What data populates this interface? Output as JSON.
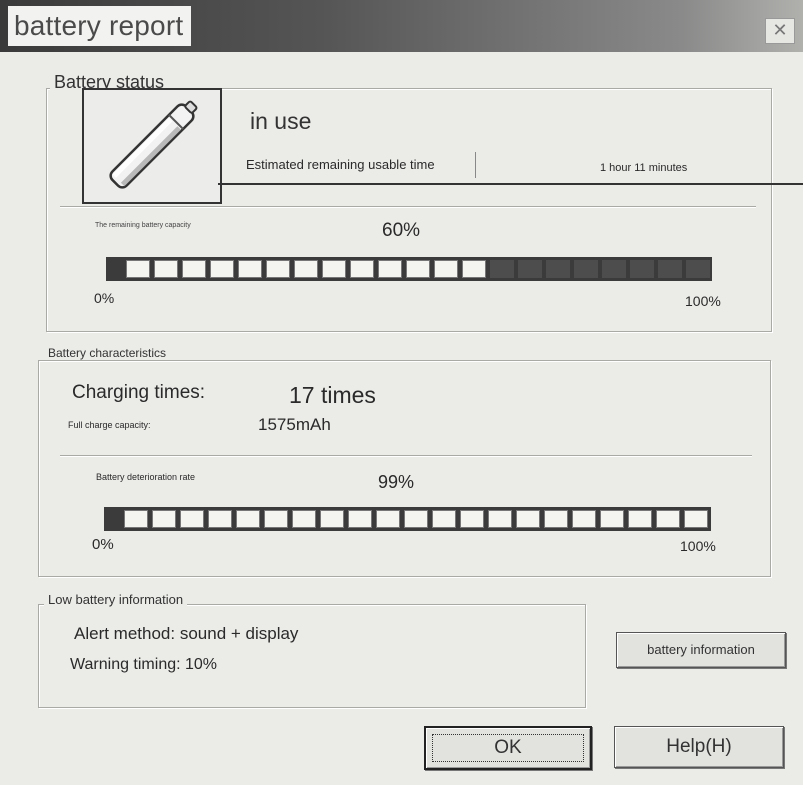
{
  "window": {
    "title": "battery report",
    "close_symbol": "✕"
  },
  "battery_status": {
    "legend": "Battery status",
    "state": "in use",
    "remaining_time_label": "Estimated remaining usable time",
    "remaining_time_value": "1 hour 11 minutes",
    "capacity_label": "The remaining battery capacity",
    "capacity_percent": "60%",
    "capacity_fraction": 0.6,
    "min_label": "0%",
    "max_label": "100%"
  },
  "battery_characteristics": {
    "legend": "Battery characteristics",
    "charging_label": "Charging times:",
    "charging_value": "17 times",
    "full_charge_label": "Full charge capacity:",
    "full_charge_value": "1575mAh",
    "deterioration_label": "Battery deterioration rate",
    "deterioration_percent": "99%",
    "deterioration_fraction": 0.99,
    "min_label": "0%",
    "max_label": "100%"
  },
  "low_battery": {
    "legend": "Low battery information",
    "alert_method": "Alert method: sound + display",
    "warning_timing": "Warning timing: 10%"
  },
  "buttons": {
    "battery_information": "battery information",
    "ok": "OK",
    "help": "Help(H)"
  },
  "icons": {
    "battery": "battery-icon",
    "close": "close-icon"
  }
}
